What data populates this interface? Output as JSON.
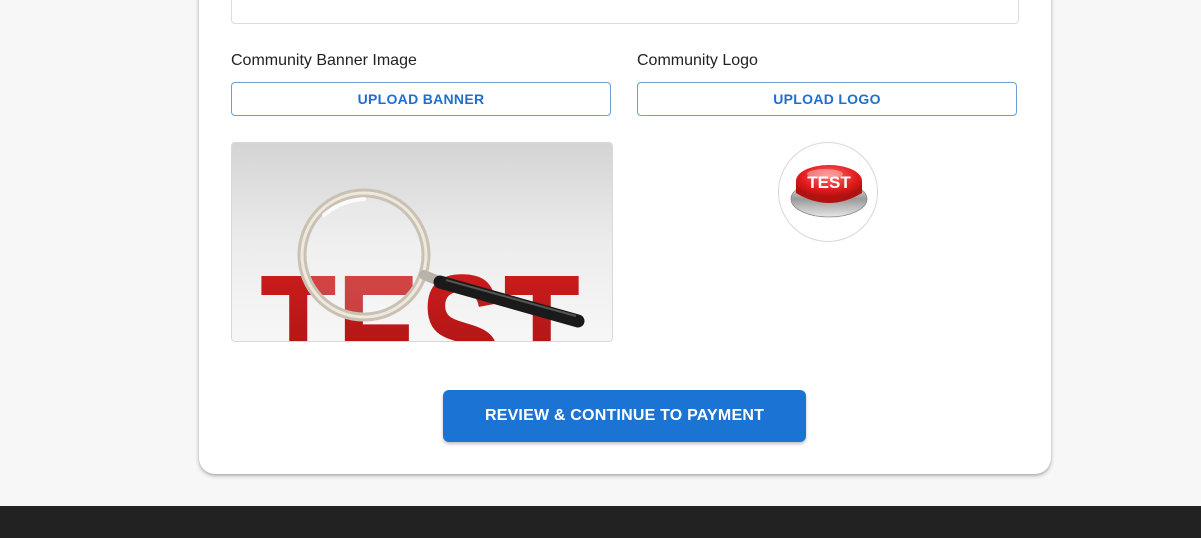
{
  "form": {
    "banner_label": "Community Banner Image",
    "logo_label": "Community Logo",
    "upload_banner_label": "UPLOAD BANNER",
    "upload_logo_label": "UPLOAD LOGO",
    "banner_image_text": "TEST",
    "logo_image_text": "TEST",
    "submit_label": "REVIEW & CONTINUE TO PAYMENT"
  },
  "colors": {
    "accent": "#1b74d3",
    "outline": "#6a9fd8",
    "footer": "#222222",
    "page_bg": "#f7f7f7"
  },
  "icons": {
    "banner_image": "magnifying-glass-over-test-text",
    "logo_image": "red-test-push-button"
  }
}
